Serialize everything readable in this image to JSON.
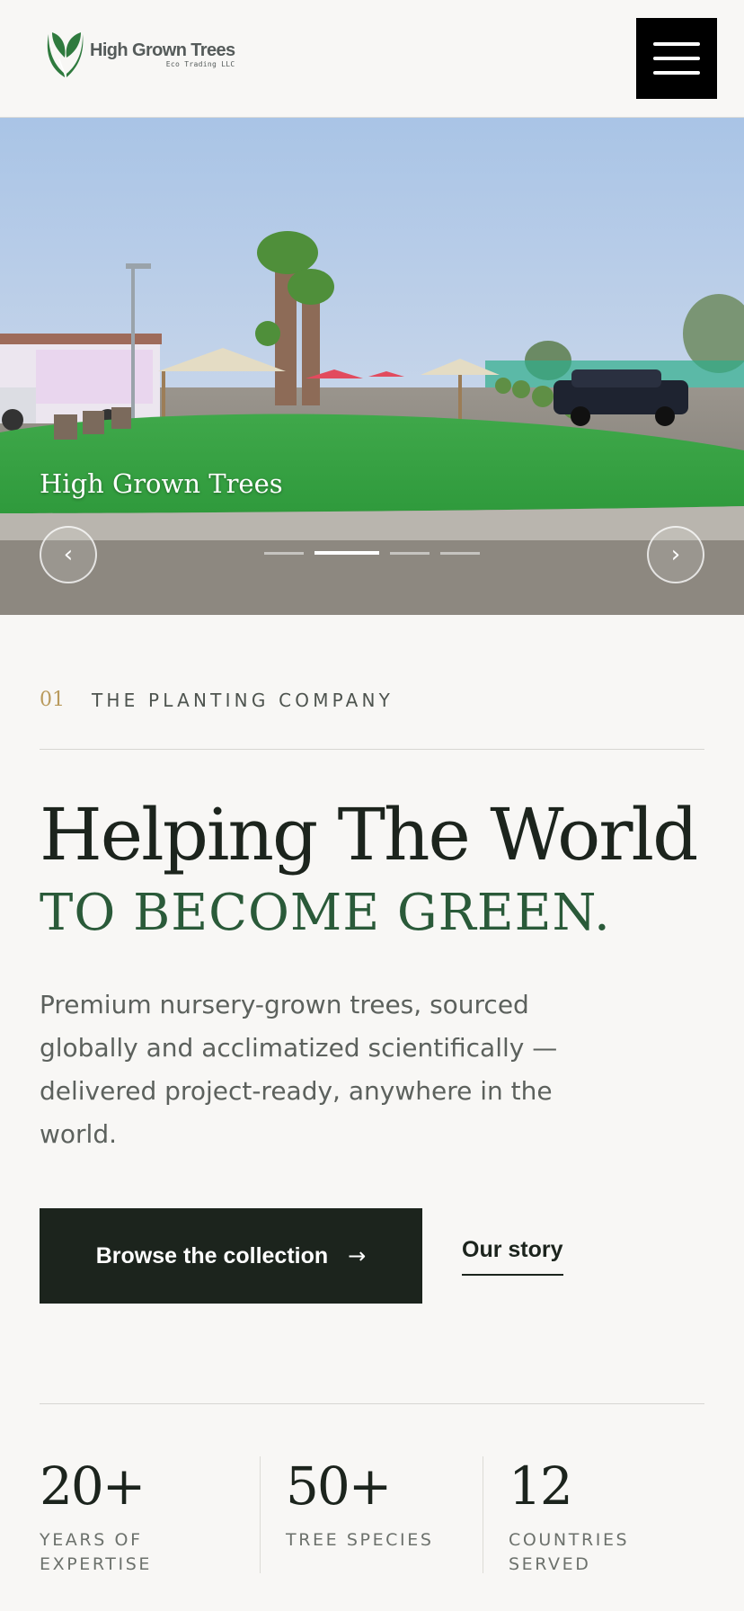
{
  "header": {
    "logo_name": "High Grown Trees",
    "logo_sub": "Eco Trading LLC",
    "logo_icon": "leaf-logo-icon",
    "menu_icon": "hamburger-icon"
  },
  "hero": {
    "caption": "High Grown Trees",
    "prev_icon": "‹",
    "next_icon": "›",
    "slides_total": 4,
    "active_slide": 2
  },
  "intro": {
    "eyebrow_number": "01",
    "eyebrow_label": "THE PLANTING COMPANY",
    "headline": "Helping The World",
    "subheadline": "TO BECOME GREEN.",
    "description": "Premium nursery-grown trees, sourced globally and acclimatized scientifically — delivered project-ready, anywhere in the world."
  },
  "actions": {
    "primary_label": "Browse the collection",
    "primary_arrow": "→",
    "secondary_label": "Our story"
  },
  "stats": [
    {
      "value": "20+",
      "label": "YEARS OF EXPERTISE"
    },
    {
      "value": "50+",
      "label": "TREE SPECIES"
    },
    {
      "value": "12",
      "label": "COUNTRIES SERVED"
    }
  ],
  "colors": {
    "brand_green": "#2a5a39",
    "dark": "#1c241d",
    "gold": "#b99a5c",
    "background": "#f8f7f5"
  }
}
